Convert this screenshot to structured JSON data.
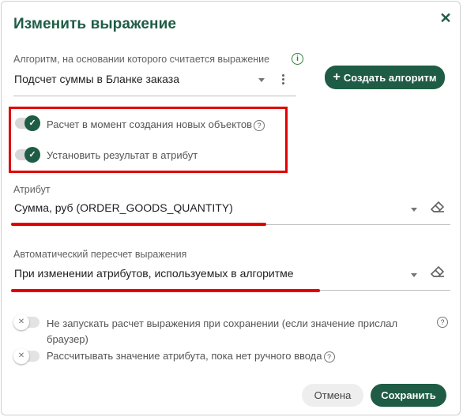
{
  "dialog": {
    "title": "Изменить выражение",
    "close_icon": "close-icon"
  },
  "algorithm": {
    "label": "Алгоритм, на основании которого считается выражение",
    "value": "Подсчет суммы в Бланке заказа",
    "info_icon": "info-icon",
    "create_button": "Создать алгоритм",
    "create_icon": "plus-icon"
  },
  "toggles_highlighted": [
    {
      "label": "Расчет в момент создания новых объектов",
      "state": "on",
      "help": "?"
    },
    {
      "label": "Установить результат в атрибут",
      "state": "on"
    }
  ],
  "attribute": {
    "label": "Атрибут",
    "value": "Сумма, руб (ORDER_GOODS_QUANTITY)"
  },
  "recalc": {
    "label": "Автоматический пересчет выражения",
    "value": "При изменении атрибутов, используемых в алгоритме"
  },
  "toggles_bottom": [
    {
      "label_line1": "Не запускать расчет выражения при сохранении (если значение прислал",
      "label_line2": "браузер)",
      "state": "off",
      "help": "?"
    },
    {
      "label": "Рассчитывать значение атрибута, пока нет ручного ввода",
      "state": "off",
      "help": "?"
    }
  ],
  "footer": {
    "cancel": "Отмена",
    "save": "Сохранить"
  },
  "colors": {
    "accent": "#1f5c45",
    "annotation": "#e00000"
  }
}
